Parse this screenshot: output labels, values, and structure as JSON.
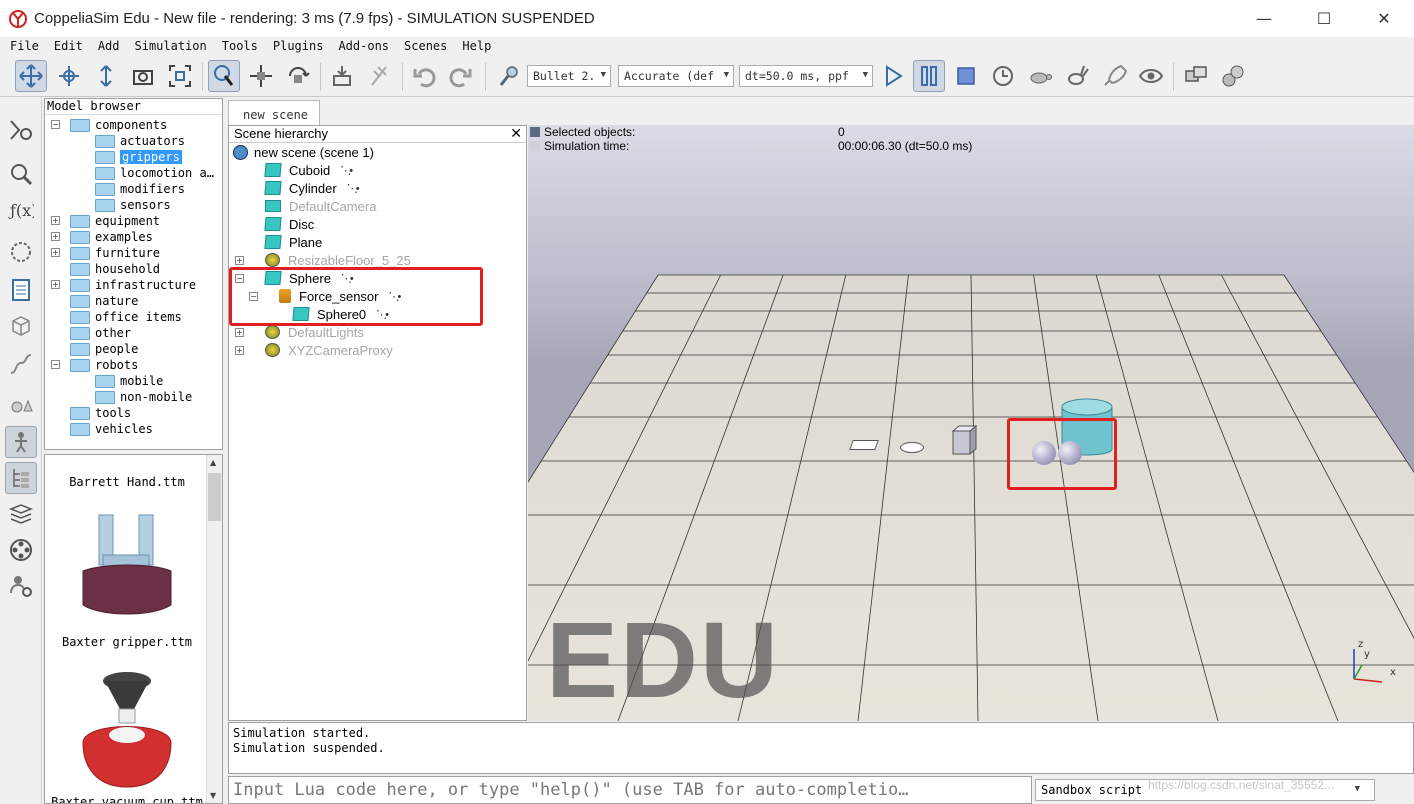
{
  "window": {
    "title": "CoppeliaSim Edu - New file - rendering: 3 ms (7.9 fps) - SIMULATION SUSPENDED",
    "controls": [
      "—",
      "☐",
      "✕"
    ]
  },
  "menu": [
    "File",
    "Edit",
    "Add",
    "Simulation",
    "Tools",
    "Plugins",
    "Add-ons",
    "Scenes",
    "Help"
  ],
  "toolbar": {
    "engine": "Bullet 2.",
    "accuracy": "Accurate (def",
    "timestep": "dt=50.0 ms, ppf"
  },
  "model_browser": {
    "title": "Model browser",
    "tree": [
      {
        "label": "components",
        "level": 0,
        "expanded": true
      },
      {
        "label": "actuators",
        "level": 1
      },
      {
        "label": "grippers",
        "level": 1,
        "selected": true
      },
      {
        "label": "locomotion a…",
        "level": 1
      },
      {
        "label": "modifiers",
        "level": 1
      },
      {
        "label": "sensors",
        "level": 1
      },
      {
        "label": "equipment",
        "level": 0,
        "collapsed": true
      },
      {
        "label": "examples",
        "level": 0,
        "collapsed": true
      },
      {
        "label": "furniture",
        "level": 0,
        "collapsed": true
      },
      {
        "label": "household",
        "level": 0
      },
      {
        "label": "infrastructure",
        "level": 0,
        "collapsed": true
      },
      {
        "label": "nature",
        "level": 0
      },
      {
        "label": "office items",
        "level": 0
      },
      {
        "label": "other",
        "level": 0
      },
      {
        "label": "people",
        "level": 0
      },
      {
        "label": "robots",
        "level": 0,
        "expanded": true
      },
      {
        "label": "mobile",
        "level": 1
      },
      {
        "label": "non-mobile",
        "level": 1
      },
      {
        "label": "tools",
        "level": 0
      },
      {
        "label": "vehicles",
        "level": 0
      }
    ],
    "thumbnails": [
      "Barrett Hand.ttm",
      "Baxter gripper.ttm",
      "Baxter vacuum cup.ttm"
    ]
  },
  "scene_tab": "new scene",
  "hierarchy": {
    "title": "Scene hierarchy",
    "items": [
      {
        "label": "new scene (scene 1)",
        "level": 0,
        "icon": "globe-icon"
      },
      {
        "label": "Cuboid",
        "level": 1,
        "icon": "shape-icon"
      },
      {
        "label": "Cylinder",
        "level": 1,
        "icon": "shape-icon"
      },
      {
        "label": "DefaultCamera",
        "level": 1,
        "icon": "camera-icon",
        "dim": true
      },
      {
        "label": "Disc",
        "level": 1,
        "icon": "shape-icon"
      },
      {
        "label": "Plane",
        "level": 1,
        "icon": "shape-icon"
      },
      {
        "label": "ResizableFloor_5_25",
        "level": 1,
        "icon": "model-icon",
        "dim": true
      },
      {
        "label": "Sphere",
        "level": 1,
        "icon": "shape-icon"
      },
      {
        "label": "Force_sensor",
        "level": 2,
        "icon": "force-sensor-icon"
      },
      {
        "label": "Sphere0",
        "level": 3,
        "icon": "shape-icon"
      },
      {
        "label": "DefaultLights",
        "level": 1,
        "icon": "model-icon",
        "dim": true
      },
      {
        "label": "XYZCameraProxy",
        "level": 1,
        "icon": "model-icon",
        "dim": true
      }
    ]
  },
  "viewport": {
    "selected_label": "Selected objects:",
    "selected_value": "0",
    "simtime_label": "Simulation time:",
    "simtime_value": "00:00:06.30 (dt=50.0 ms)",
    "watermark": "EDU",
    "axes": {
      "z": "z",
      "y": "y",
      "x": "x"
    }
  },
  "console": {
    "lines": [
      "Simulation started.",
      "Simulation suspended."
    ]
  },
  "command": {
    "placeholder": "Input Lua code here, or type \"help()\" (use TAB for auto-completio…",
    "script_type": "Sandbox script"
  },
  "credit": "https://blog.csdn.net/sinat_35552..."
}
